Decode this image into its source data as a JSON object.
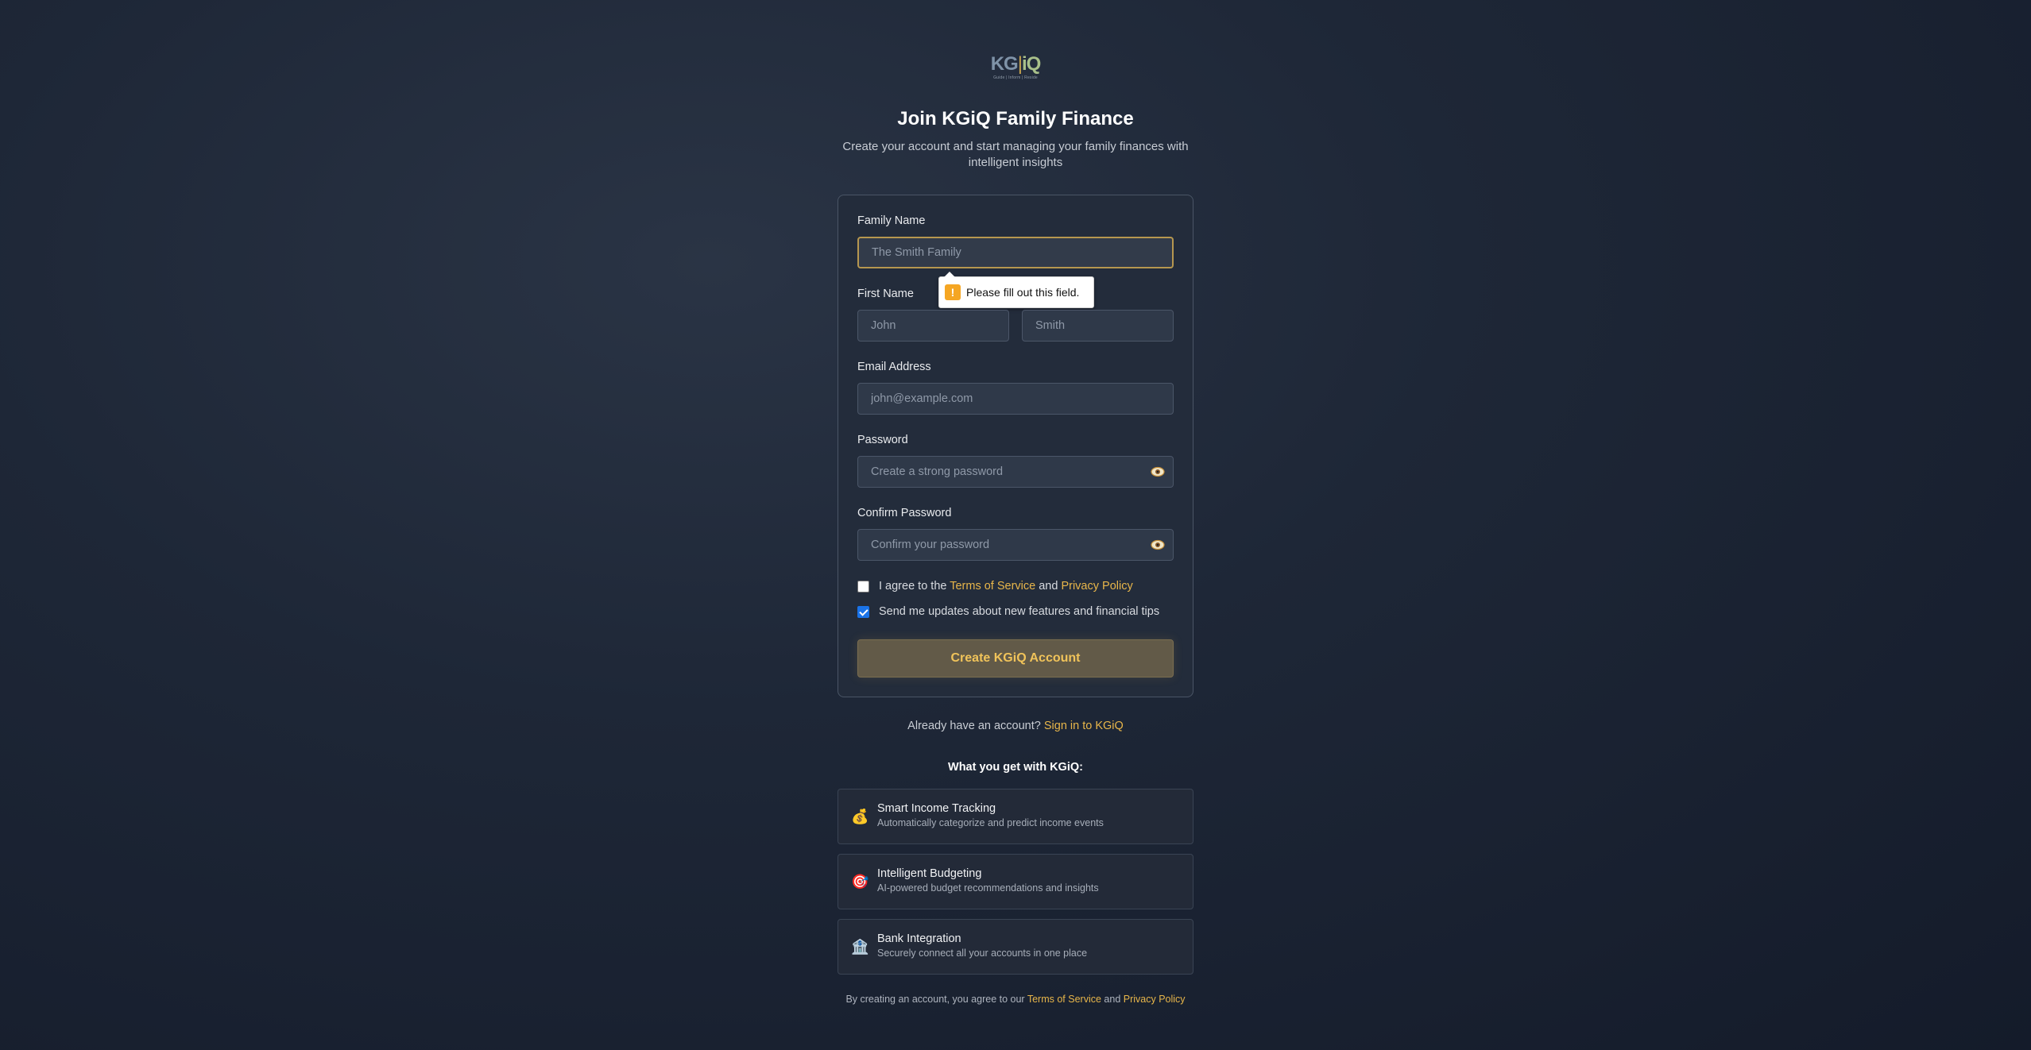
{
  "logo": {
    "kg": "KG",
    "sep": "|",
    "iq": "iQ",
    "tagline": "Guide | Inform | Reside"
  },
  "header": {
    "title": "Join KGiQ Family Finance",
    "subtitle": "Create your account and start managing your family finances with intelligent insights"
  },
  "form": {
    "family_name": {
      "label": "Family Name",
      "placeholder": "The Smith Family",
      "value": ""
    },
    "first_name": {
      "label": "First Name",
      "placeholder": "John",
      "value": ""
    },
    "last_name": {
      "placeholder": "Smith",
      "value": ""
    },
    "email": {
      "label": "Email Address",
      "placeholder": "john@example.com",
      "value": ""
    },
    "password": {
      "label": "Password",
      "placeholder": "Create a strong password",
      "value": ""
    },
    "confirm_password": {
      "label": "Confirm Password",
      "placeholder": "Confirm your password",
      "value": ""
    },
    "validation_message": "Please fill out this field.",
    "terms": {
      "prefix": "I agree to the ",
      "terms_link": "Terms of Service",
      "and": " and ",
      "privacy_link": "Privacy Policy",
      "checked": false
    },
    "updates": {
      "label": "Send me updates about new features and financial tips",
      "checked": true
    },
    "submit_label": "Create KGiQ Account"
  },
  "signin": {
    "prefix": "Already have an account? ",
    "link": "Sign in to KGiQ"
  },
  "features": {
    "heading": "What you get with KGiQ:",
    "items": [
      {
        "icon": "money-bag-icon",
        "glyph": "💰",
        "title": "Smart Income Tracking",
        "desc": "Automatically categorize and predict income events"
      },
      {
        "icon": "target-icon",
        "glyph": "🎯",
        "title": "Intelligent Budgeting",
        "desc": "AI-powered budget recommendations and insights"
      },
      {
        "icon": "bank-icon",
        "glyph": "🏦",
        "title": "Bank Integration",
        "desc": "Securely connect all your accounts in one place"
      }
    ]
  },
  "footer": {
    "prefix": "By creating an account, you agree to our ",
    "terms_link": "Terms of Service",
    "and": " and ",
    "privacy_link": "Privacy Policy"
  },
  "colors": {
    "accent_gold": "#e8b64a",
    "background": "#1e2737",
    "card": "#232c3b",
    "checkbox_checked": "#1a73e8"
  }
}
